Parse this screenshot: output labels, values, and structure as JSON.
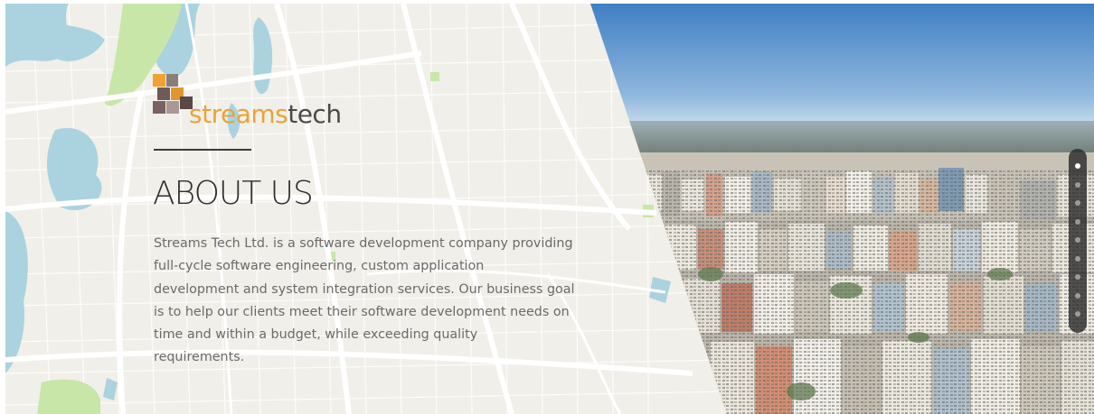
{
  "logo": {
    "text_part1": "streams",
    "text_part2": "tech",
    "color_part1": "#e8a33a",
    "color_part2": "#4a4a4a"
  },
  "about": {
    "title": "ABOUT US",
    "description_lines": [
      "Streams Tech Ltd. is a software development company providing",
      "full-cycle software engineering, custom application",
      "development and system integration services. Our business goal",
      "is to help our clients meet their software development needs on",
      "time and within a budget, while exceeding quality",
      "requirements."
    ]
  },
  "slide_nav": {
    "dot_count": 9,
    "active_index": 0
  },
  "colors": {
    "map_background": "#f1efe9",
    "water": "#aad3df",
    "park": "#c8e6a7",
    "sky_top": "#3f7fc4",
    "sky_horizon": "#c7dcec"
  },
  "icons": {
    "logo_mark": "checker-squares-icon"
  }
}
